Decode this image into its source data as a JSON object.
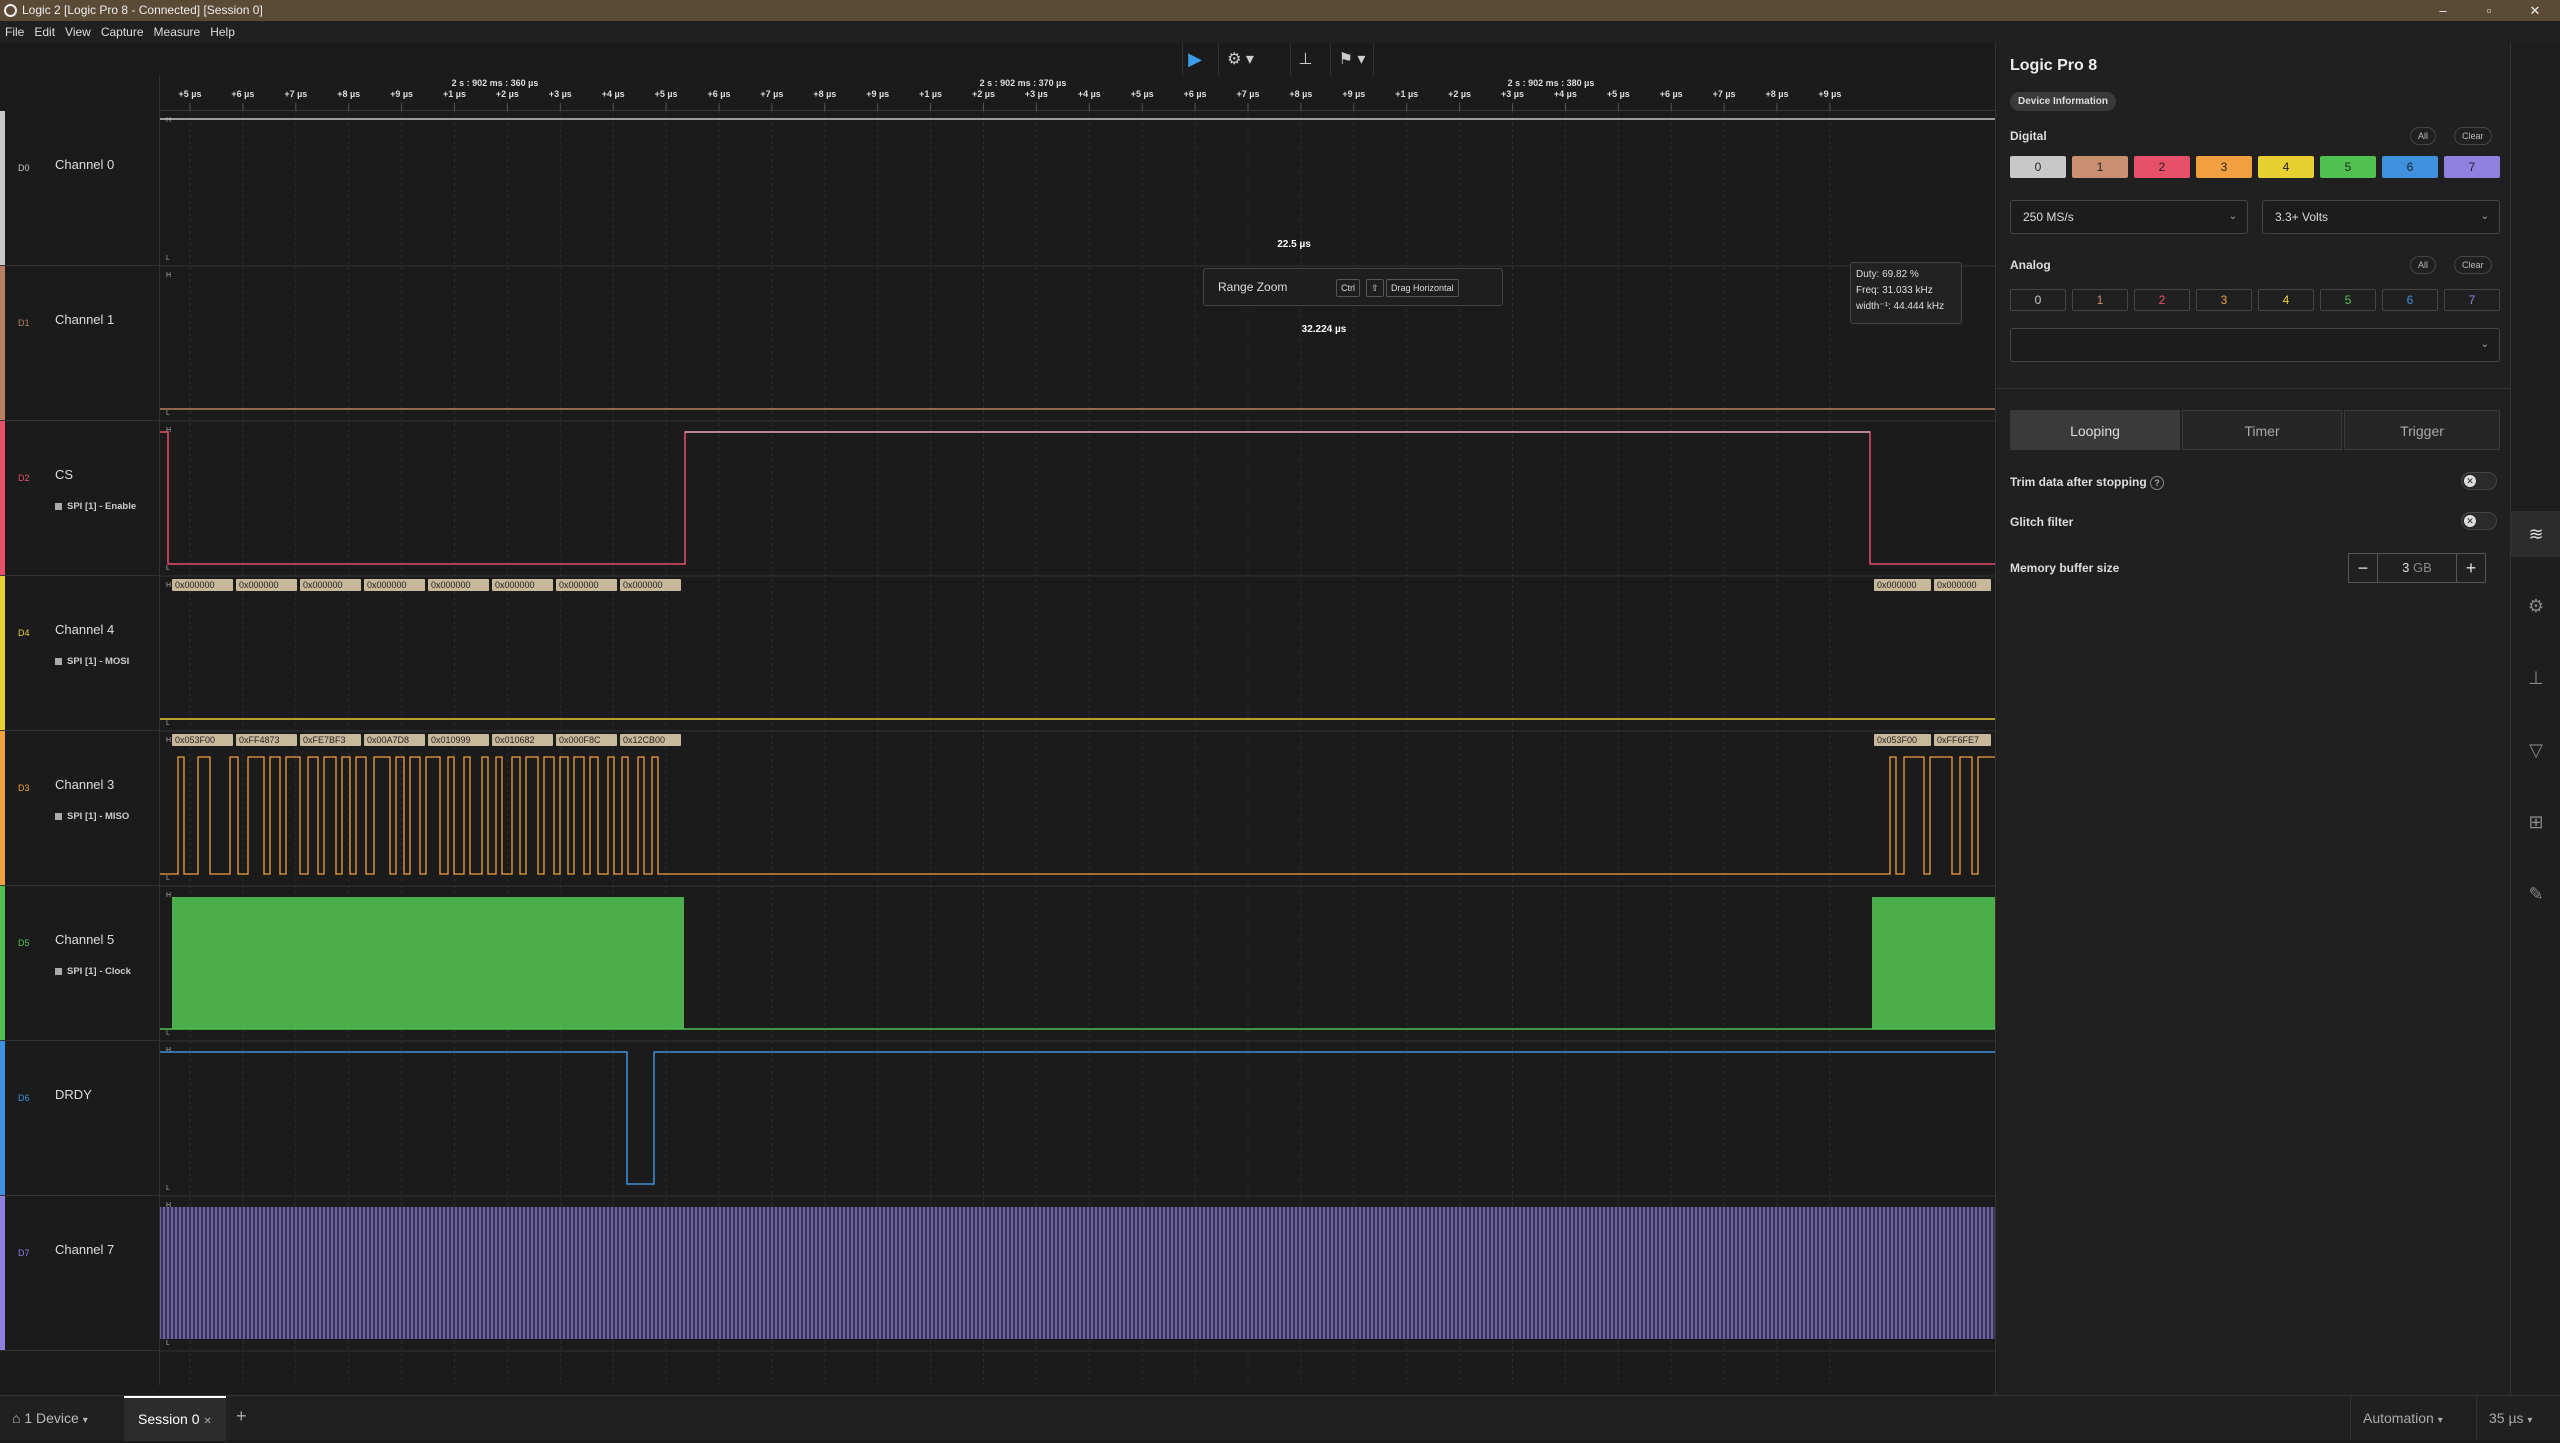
{
  "window": {
    "title": "Logic 2 [Logic Pro 8 - Connected] [Session 0]"
  },
  "menu": [
    "File",
    "Edit",
    "View",
    "Capture",
    "Measure",
    "Help"
  ],
  "ruler": {
    "major_labels": [
      "2 s : 902 ms : 360 µs",
      "2 s : 902 ms : 370 µs",
      "2 s : 902 ms : 380 µs"
    ],
    "ticks": [
      "+5 µs",
      "+6 µs",
      "+7 µs",
      "+8 µs",
      "+9 µs",
      "+1 µs",
      "+2 µs",
      "+3 µs",
      "+4 µs",
      "+5 µs",
      "+6 µs",
      "+7 µs",
      "+8 µs",
      "+9 µs",
      "+1 µs",
      "+2 µs",
      "+3 µs",
      "+4 µs",
      "+5 µs",
      "+6 µs",
      "+7 µs",
      "+8 µs",
      "+9 µs",
      "+1 µs",
      "+2 µs",
      "+3 µs",
      "+4 µs",
      "+5 µs",
      "+6 µs",
      "+7 µs",
      "+8 µs",
      "+9 µs"
    ]
  },
  "channels": [
    {
      "num": "D0",
      "name": "Channel 0",
      "sub": "",
      "color": "#c8c8c8"
    },
    {
      "num": "D1",
      "name": "Channel 1",
      "sub": "",
      "color": "#b88060"
    },
    {
      "num": "D2",
      "name": "CS",
      "sub": "SPI [1] - Enable",
      "color": "#e8506a"
    },
    {
      "num": "D4",
      "name": "Channel 4",
      "sub": "SPI [1] - MOSI",
      "color": "#e8d030"
    },
    {
      "num": "D3",
      "name": "Channel 3",
      "sub": "SPI [1] - MISO",
      "color": "#f0a040"
    },
    {
      "num": "D5",
      "name": "Channel 5",
      "sub": "SPI [1] - Clock",
      "color": "#50c050"
    },
    {
      "num": "D6",
      "name": "DRDY",
      "sub": "",
      "color": "#4090e0"
    },
    {
      "num": "D7",
      "name": "Channel 7",
      "sub": "",
      "color": "#9080e0"
    }
  ],
  "mosi_frames": [
    "0x000000",
    "0x000000",
    "0x000000",
    "0x000000",
    "0x000000",
    "0x000000",
    "0x000000",
    "0x000000"
  ],
  "mosi_frames_right": [
    "0x000000",
    "0x000000"
  ],
  "miso_frames": [
    "0x053F00",
    "0xFF4873",
    "0xFE7BF3",
    "0x00A7D8",
    "0x010999",
    "0x010682",
    "0x000F8C",
    "0x12CB00"
  ],
  "miso_frames_right": [
    "0x053F00",
    "0xFF6FE7"
  ],
  "measurements": {
    "width_top": "22.5 µs",
    "width_bottom": "32.224 µs",
    "duty": "Duty: 69.82 %",
    "freq": "Freq: 31.033 kHz",
    "width_freq": "width⁻¹: 44.444 kHz"
  },
  "tooltip": {
    "label": "Range Zoom",
    "key1": "Ctrl",
    "key2": "⇧",
    "action": "Drag Horizontal"
  },
  "panel": {
    "title": "Logic Pro 8",
    "device_info": "Device Information",
    "digital_label": "Digital",
    "analog_label": "Analog",
    "all": "All",
    "clear": "Clear",
    "digital": [
      "0",
      "1",
      "2",
      "3",
      "4",
      "5",
      "6",
      "7"
    ],
    "digital_colors": [
      "#c8c8c8",
      "#c89070",
      "#e8506a",
      "#f0a040",
      "#e8d030",
      "#50c050",
      "#4090e0",
      "#9080e0"
    ],
    "analog": [
      "0",
      "1",
      "2",
      "3",
      "4",
      "5",
      "6",
      "7"
    ],
    "sample_rate": "250 MS/s",
    "voltage": "3.3+ Volts",
    "analog_rate": "",
    "tabs": [
      "Looping",
      "Timer",
      "Trigger"
    ],
    "trim_label": "Trim data after stopping",
    "glitch_label": "Glitch filter",
    "memory_label": "Memory buffer size",
    "memory_value": "3",
    "memory_unit": "GB"
  },
  "status": {
    "device": "1 Device",
    "session": "Session 0",
    "mode": "Automation",
    "zoom": "35 µs"
  }
}
